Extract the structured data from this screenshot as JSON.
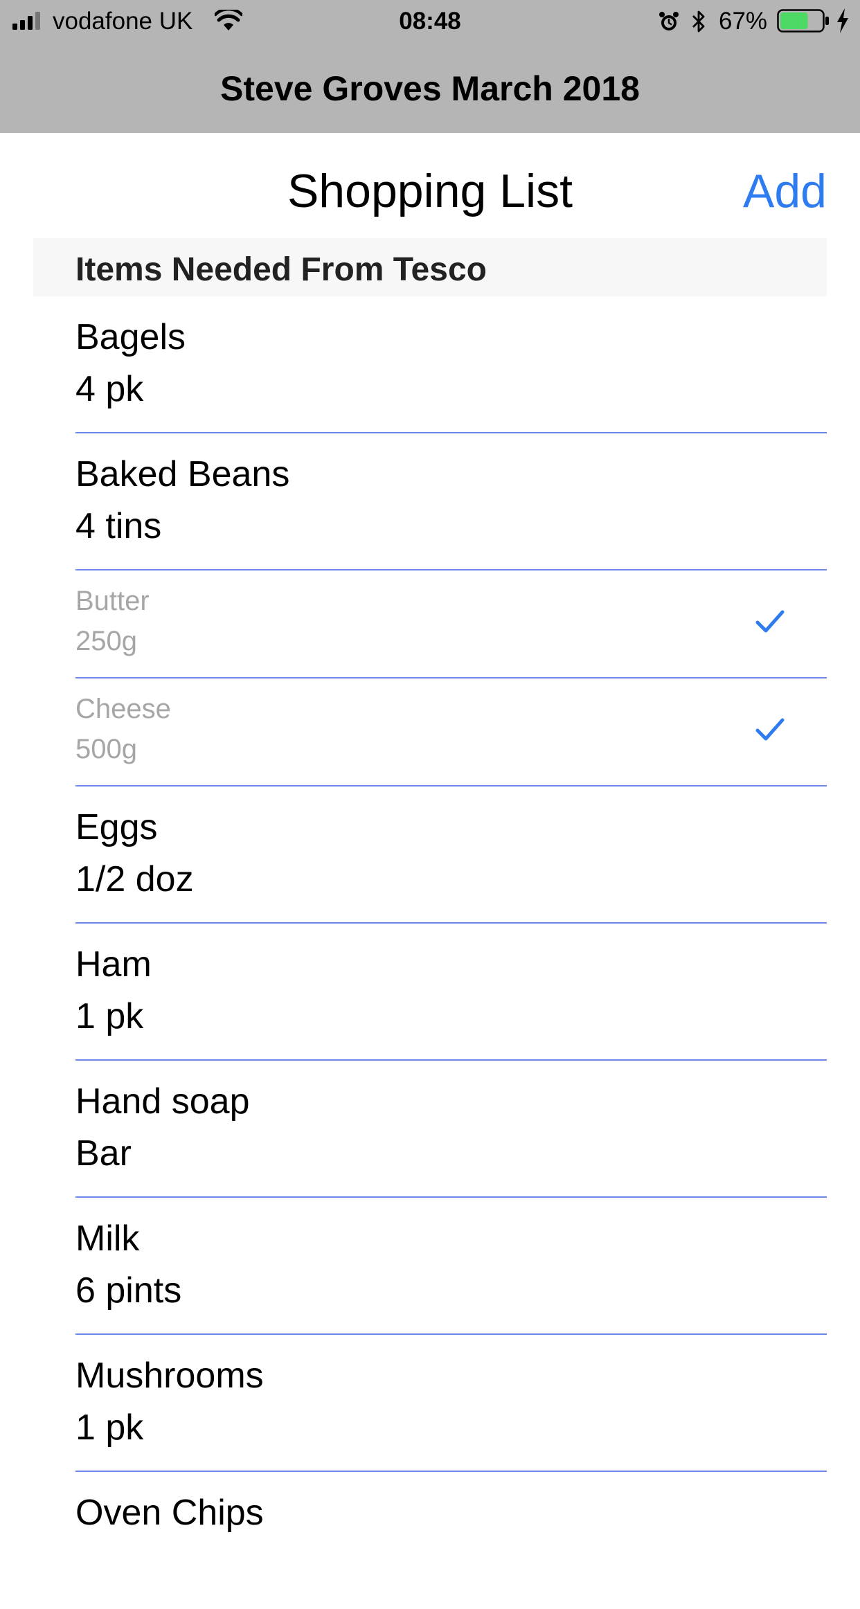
{
  "status_bar": {
    "carrier": "vodafone UK",
    "time": "08:48",
    "battery_percent": "67%",
    "battery_level": 0.67,
    "battery_color": "#4cd964"
  },
  "app_title": "Steve Groves March 2018",
  "nav": {
    "title": "Shopping List",
    "add_label": "Add",
    "accent_color": "#2f7bf0"
  },
  "section": {
    "title": "Items Needed From Tesco"
  },
  "items": [
    {
      "name": "Bagels",
      "qty": "4 pk",
      "done": false
    },
    {
      "name": "Baked Beans",
      "qty": "4 tins",
      "done": false
    },
    {
      "name": "Butter",
      "qty": "250g",
      "done": true
    },
    {
      "name": "Cheese",
      "qty": "500g",
      "done": true
    },
    {
      "name": "Eggs",
      "qty": "1/2 doz",
      "done": false
    },
    {
      "name": "Ham",
      "qty": "1 pk",
      "done": false
    },
    {
      "name": "Hand soap",
      "qty": "Bar",
      "done": false
    },
    {
      "name": "Milk",
      "qty": "6 pints",
      "done": false
    },
    {
      "name": "Mushrooms",
      "qty": "1 pk",
      "done": false
    },
    {
      "name": "Oven Chips",
      "qty": "",
      "done": false
    }
  ]
}
